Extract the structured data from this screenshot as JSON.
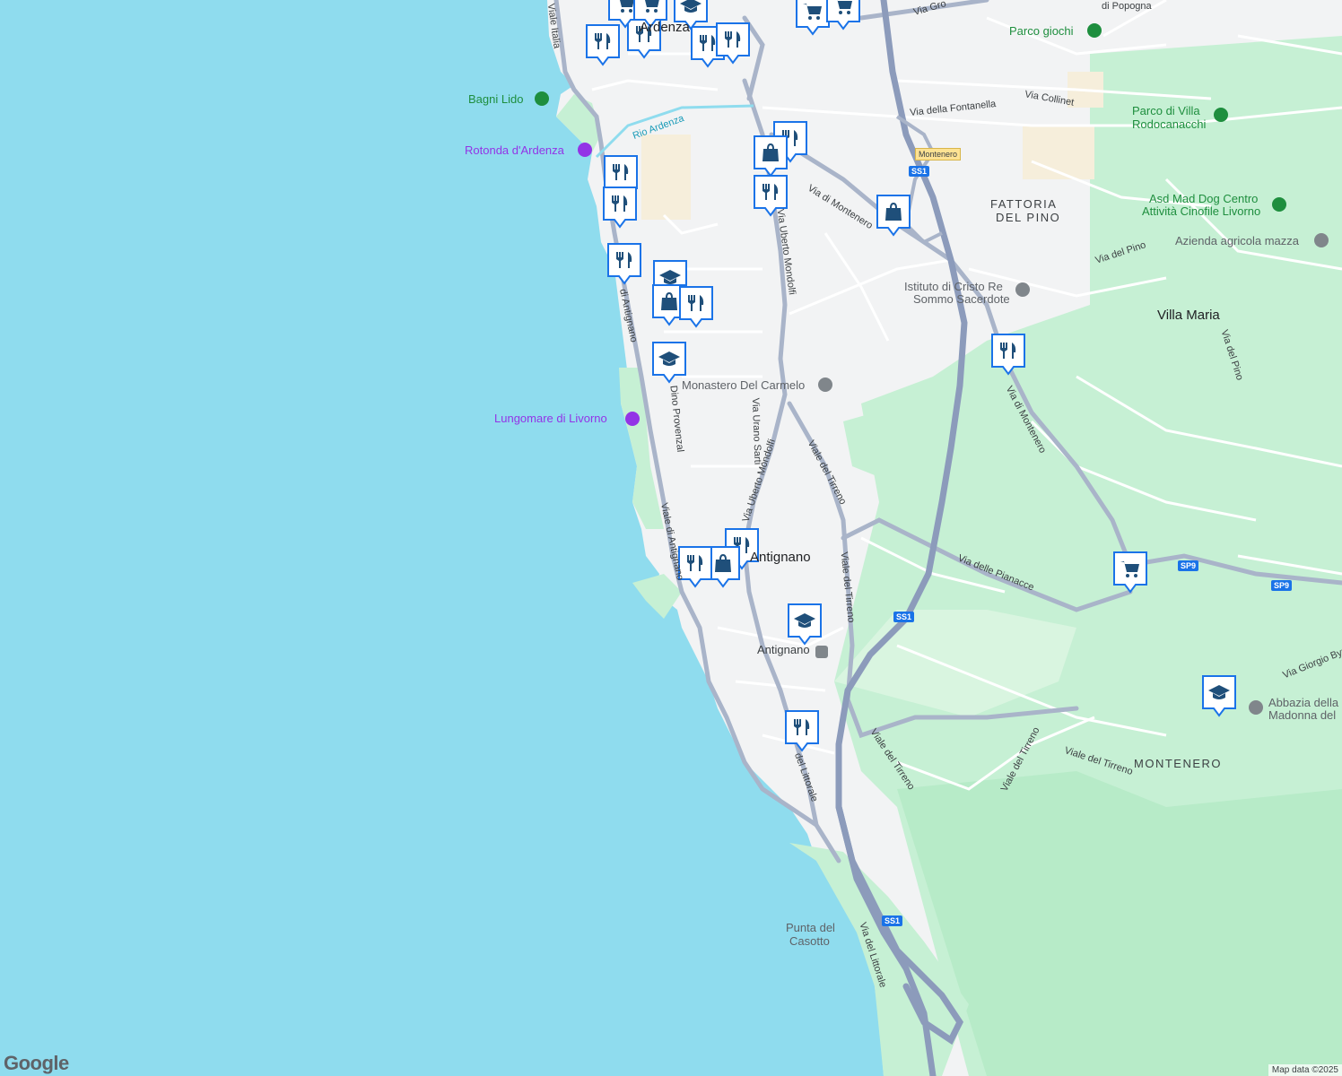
{
  "colors": {
    "water": "#8fdcee",
    "land": "#f2f3f4",
    "park": "#c6f0d4",
    "road": "#9aa7bf",
    "road_minor": "#ffffff",
    "highway": "#8c9bbb",
    "pin": "#1f6aa5",
    "purple": "#9334e6",
    "green": "#1e8e3e"
  },
  "map_labels": {
    "ardenza": "Ardenza",
    "antignano_place": "Antignano",
    "villa_maria": "Villa Maria",
    "montenero": "MONTENERO",
    "fattoria_line1": "FATTORIA",
    "fattoria_line2": "DEL PINO",
    "bagni_lido": "Bagni Lido",
    "rotonda": "Rotonda d'Ardenza",
    "lungomare": "Lungomare di Livorno",
    "parco_giochi": "Parco giochi",
    "parco_villa_l1": "Parco di Villa",
    "parco_villa_l2": "Rodocanacchi",
    "asd_l1": "Asd Mad Dog Centro",
    "asd_l2": "Attività Cinofile Livorno",
    "azienda": "Azienda agricola mazza",
    "istituto_l1": "Istituto di Cristo Re",
    "istituto_l2": "Sommo Sacerdote",
    "monastero": "Monastero Del Carmelo",
    "abbazia_l1": "Abbazia della",
    "abbazia_l2": "Madonna del",
    "punta_l1": "Punta del",
    "punta_l2": "Casotto",
    "antignano_station": "Antignano",
    "rio_ardenza": "Rio Ardenza"
  },
  "road_labels": {
    "viale_italia": "Viale Italia",
    "viale_antignano_top": "di Antignano",
    "viale_antignano": "Viale di Antignano",
    "dino_provenzal": "Dino Provenzal",
    "via_urano_sarti": "Via Urano Sarti",
    "via_uberto_top": "Uberto Mondolfi",
    "via_uberto": "Via Uberto Mondolfi",
    "viale_tirreno_1": "Viale del Tirreno",
    "viale_tirreno_2": "Viale del Tirreno",
    "viale_tirreno_3": "Viale del Tirreno",
    "viale_tirreno_4": "Viale del Tirreno",
    "viale_tirreno_5": "Viale del Tirreno",
    "via_montenero_1": "Via di Montenero",
    "via_montenero_2": "Via di Montenero",
    "via_fontanella": "Via della Fontanella",
    "via_collinet": "Via Collinet",
    "via_del_pino_1": "Via del Pino",
    "via_del_pino_2": "Via del Pino",
    "via_pianacce": "Via delle Pianacce",
    "via_littorale_1": "del Littorale",
    "via_littorale_2": "Via del Littorale",
    "via_giorgio": "Via Giorgio Byr",
    "via_popogna": "di Popogna",
    "via_gro": "Via Gro"
  },
  "shields": {
    "ss1_a": "SS1",
    "ss1_b": "SS1",
    "ss1_c": "SS1",
    "sp9_a": "SP9",
    "sp9_b": "SP9",
    "montenero_tag": "Montenero"
  },
  "pins": {
    "types": [
      "restaurant",
      "shopping",
      "grocery",
      "education"
    ]
  },
  "footer": {
    "map_data": "Map data ©2025",
    "logo": "Google"
  }
}
